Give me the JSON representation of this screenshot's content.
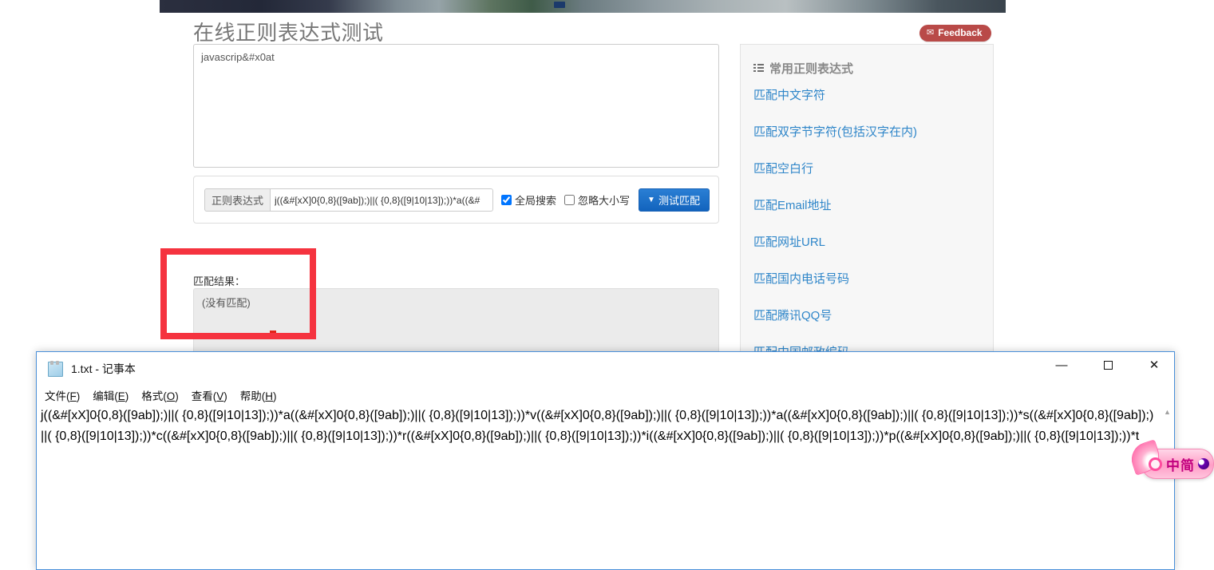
{
  "page": {
    "title": "在线正则表达式测试",
    "feedback": {
      "label": "Feedback",
      "icon": "envelope-icon"
    }
  },
  "test_area": {
    "value": "javascrip&#x0at"
  },
  "regex_form": {
    "addon_label": "正则表达式",
    "pattern_value": "j((&#[xX]0{0,8}([9ab]);)||( {0,8}([9|10|13]);))*a((&#",
    "global_search": {
      "label": "全局搜索",
      "checked": true
    },
    "ignore_case": {
      "label": "忽略大小写",
      "checked": false
    },
    "test_button": {
      "label": "测试匹配",
      "caret": "chevron-down-icon"
    }
  },
  "result": {
    "label": "匹配结果：",
    "text": "(没有匹配)"
  },
  "sidebar": {
    "title": "常用正则表达式",
    "title_icon": "list-icon",
    "items": [
      {
        "label": "匹配中文字符"
      },
      {
        "label": "匹配双字节字符(包括汉字在内)"
      },
      {
        "label": "匹配空白行"
      },
      {
        "label": "匹配Email地址"
      },
      {
        "label": "匹配网址URL"
      },
      {
        "label": "匹配国内电话号码"
      },
      {
        "label": "匹配腾讯QQ号"
      },
      {
        "label": "匹配中国邮政编码"
      }
    ]
  },
  "notepad": {
    "title": "1.txt - 记事本",
    "icon": "notepad-icon",
    "window_buttons": {
      "minimize": "—",
      "maximize": "□",
      "close": "✕"
    },
    "menu": [
      {
        "label": "文件(F)",
        "text": "文件(",
        "accel": "F",
        "tail": ")"
      },
      {
        "label": "编辑(E)",
        "text": "编辑(",
        "accel": "E",
        "tail": ")"
      },
      {
        "label": "格式(O)",
        "text": "格式(",
        "accel": "O",
        "tail": ")"
      },
      {
        "label": "查看(V)",
        "text": "查看(",
        "accel": "V",
        "tail": ")"
      },
      {
        "label": "帮助(H)",
        "text": "帮助(",
        "accel": "H",
        "tail": ")"
      }
    ],
    "content": "j((&#[xX]0{0,8}([9ab]);)||( {0,8}([9|10|13]);))*a((&#[xX]0{0,8}([9ab]);)||( {0,8}([9|10|13]);))*v((&#[xX]0{0,8}([9ab]);)||( {0,8}([9|10|13]);))*a((&#[xX]0{0,8}([9ab]);)||( {0,8}([9|10|13]);))*s((&#[xX]0{0,8}([9ab]);)||( {0,8}([9|10|13]);))*c((&#[xX]0{0,8}([9ab]);)||( {0,8}([9|10|13]);))*r((&#[xX]0{0,8}([9ab]);)||( {0,8}([9|10|13]);))*i((&#[xX]0{0,8}([9ab]);)||( {0,8}([9|10|13]);))*p((&#[xX]0{0,8}([9ab]);)||( {0,8}([9|10|13]);))*t",
    "scroll_up": "▲"
  },
  "floating_widget": {
    "label": "中简",
    "icon": "wing-ring-icon",
    "moon": "moon-icon"
  },
  "colors": {
    "accent_blue": "#1a6ecc",
    "link_blue": "#2f86c9",
    "annotation_red": "#f5333f",
    "feedback_red": "#b94a48",
    "caret_red": "#e2231a",
    "widget_pink": "#ff9ec6"
  }
}
